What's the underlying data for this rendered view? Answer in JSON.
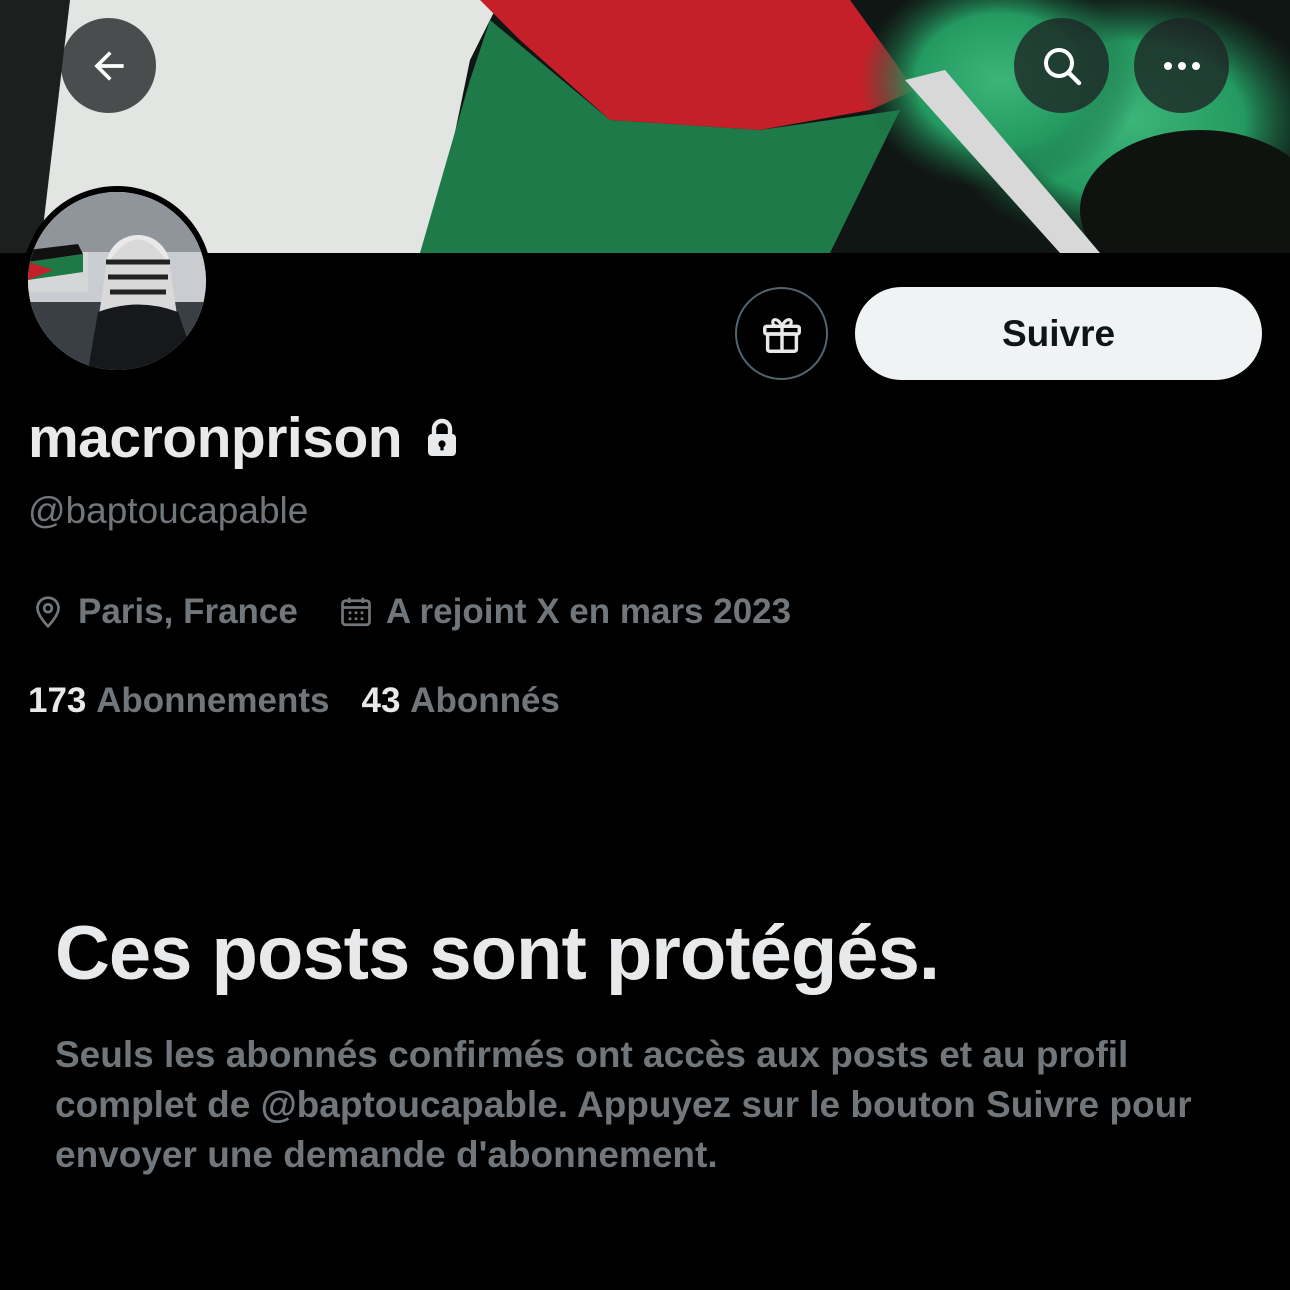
{
  "header": {
    "back_icon": "arrow-left-icon",
    "search_icon": "search-icon",
    "more_icon": "more-horizontal-icon"
  },
  "banner": {
    "description_colors": {
      "flag_red": "#c4202a",
      "flag_green": "#1f7a4a",
      "flag_white": "#e8eae8",
      "smoke_green": "#2fa36a"
    }
  },
  "profile": {
    "display_name": "macronprison",
    "lock_icon": "lock-icon",
    "handle": "@baptoucapable",
    "location": "Paris, France",
    "joined": "A rejoint X en mars 2023",
    "following_count": "173",
    "following_label": "Abonnements",
    "followers_count": "43",
    "followers_label": "Abonnés"
  },
  "actions": {
    "gift_icon": "gift-icon",
    "follow_label": "Suivre"
  },
  "protected": {
    "title": "Ces posts sont protégés.",
    "description": "Seuls les abonnés confirmés ont accès aux posts et au profil complet de @baptoucapable. Appuyez sur le bouton Suivre pour envoyer une demande d'abonnement."
  },
  "colors": {
    "background": "#000000",
    "primary_text": "#e7e9ea",
    "secondary_text": "#71767b",
    "follow_button_bg": "#eff3f4"
  }
}
